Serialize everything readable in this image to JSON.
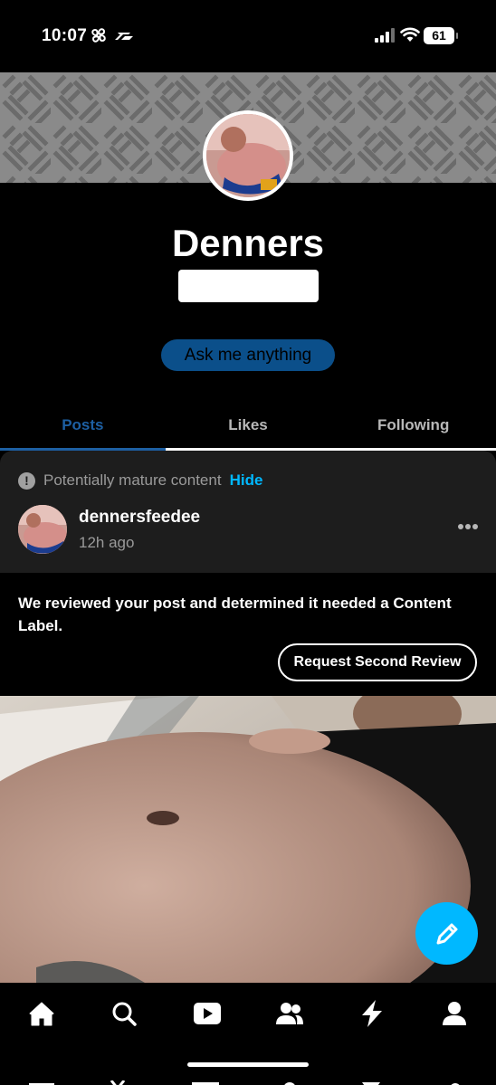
{
  "status_bar": {
    "time": "10:07",
    "battery": "61",
    "icons": [
      "fan-icon",
      "f1-logo-icon",
      "cellular-signal-icon",
      "wifi-icon",
      "battery-icon"
    ]
  },
  "profile": {
    "title": "Denners",
    "ask_button_label": "Ask me anything"
  },
  "tabs": [
    {
      "label": "Posts",
      "active": true
    },
    {
      "label": "Likes",
      "active": false
    },
    {
      "label": "Following",
      "active": false
    }
  ],
  "post": {
    "mature_notice": "Potentially mature content",
    "hide_label": "Hide",
    "username": "dennersfeedee",
    "time_ago": "12h ago",
    "content_label_notice": "We reviewed your post and determined it needed a Content Label.",
    "review_button_label": "Request Second Review"
  },
  "bottom_nav": [
    "home-icon",
    "search-icon",
    "video-icon",
    "community-icon",
    "activity-icon",
    "account-icon"
  ],
  "colors": {
    "accent": "#00b8ff",
    "active_tab": "#1d5fa2",
    "ask_button": "#0b4f8a",
    "card_bg": "#1d1d1d",
    "banner_bg": "#8a8a8a"
  }
}
